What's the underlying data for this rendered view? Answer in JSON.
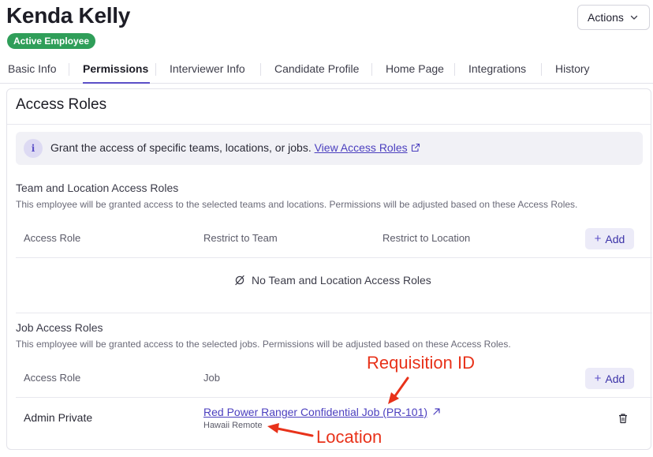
{
  "employee": {
    "name": "Kenda Kelly",
    "status_badge": "Active Employee",
    "status_color": "#2f9e59"
  },
  "header": {
    "actions_label": "Actions",
    "actions_icon": "chevron-down-icon"
  },
  "tabs": [
    {
      "label": "Basic Info",
      "active": false
    },
    {
      "label": "Permissions",
      "active": true
    },
    {
      "label": "Interviewer Info",
      "active": false
    },
    {
      "label": "Candidate Profile",
      "active": false
    },
    {
      "label": "Home Page",
      "active": false
    },
    {
      "label": "Integrations",
      "active": false
    },
    {
      "label": "History",
      "active": false
    }
  ],
  "access_roles": {
    "title": "Access Roles",
    "info": {
      "icon": "info-icon",
      "text": "Grant the access of specific teams, locations, or jobs.",
      "link_label": "View Access Roles",
      "link_icon": "external-link-icon"
    },
    "team_location": {
      "title": "Team and Location Access Roles",
      "description": "This employee will be granted access to the selected teams and locations. Permissions will be adjusted based on these Access Roles.",
      "columns": [
        "Access Role",
        "Restrict to Team",
        "Restrict to Location"
      ],
      "add_label": "Add",
      "empty_text": "No Team and Location Access Roles",
      "empty_icon": "empty-set-icon"
    },
    "job": {
      "title": "Job Access Roles",
      "description": "This employee will be granted access to the selected jobs. Permissions will be adjusted based on these Access Roles.",
      "columns": [
        "Access Role",
        "Job"
      ],
      "add_label": "Add",
      "rows": [
        {
          "role": "Admin Private",
          "job_title": "Red Power Ranger Confidential Job (PR-101)",
          "job_location": "Hawaii Remote",
          "delete_icon": "trash-icon"
        }
      ]
    }
  },
  "annotations": {
    "requisition_id": "Requisition ID",
    "location": "Location",
    "color": "#e8321a"
  },
  "colors": {
    "accent": "#5b4fc7",
    "link": "#4b3fbf"
  }
}
